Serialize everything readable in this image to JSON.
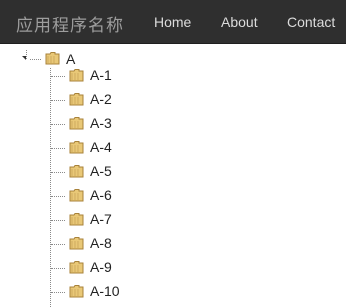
{
  "navbar": {
    "brand": "应用程序名称",
    "links": [
      {
        "label": "Home"
      },
      {
        "label": "About"
      },
      {
        "label": "Contact"
      }
    ]
  },
  "tree": {
    "root": {
      "label": "A",
      "expanded": true,
      "icon": "folder-icon",
      "children": [
        {
          "label": "A-1"
        },
        {
          "label": "A-2"
        },
        {
          "label": "A-3"
        },
        {
          "label": "A-4"
        },
        {
          "label": "A-5"
        },
        {
          "label": "A-6"
        },
        {
          "label": "A-7"
        },
        {
          "label": "A-8"
        },
        {
          "label": "A-9"
        },
        {
          "label": "A-10"
        }
      ]
    }
  },
  "colors": {
    "navbar_bg": "#2f2f2f",
    "brand_text": "#9d9d9d",
    "nav_text": "#dcdcdc",
    "folder_fill": "#e9c877",
    "folder_stroke": "#a8823a",
    "tree_line": "#8a8a8a"
  }
}
